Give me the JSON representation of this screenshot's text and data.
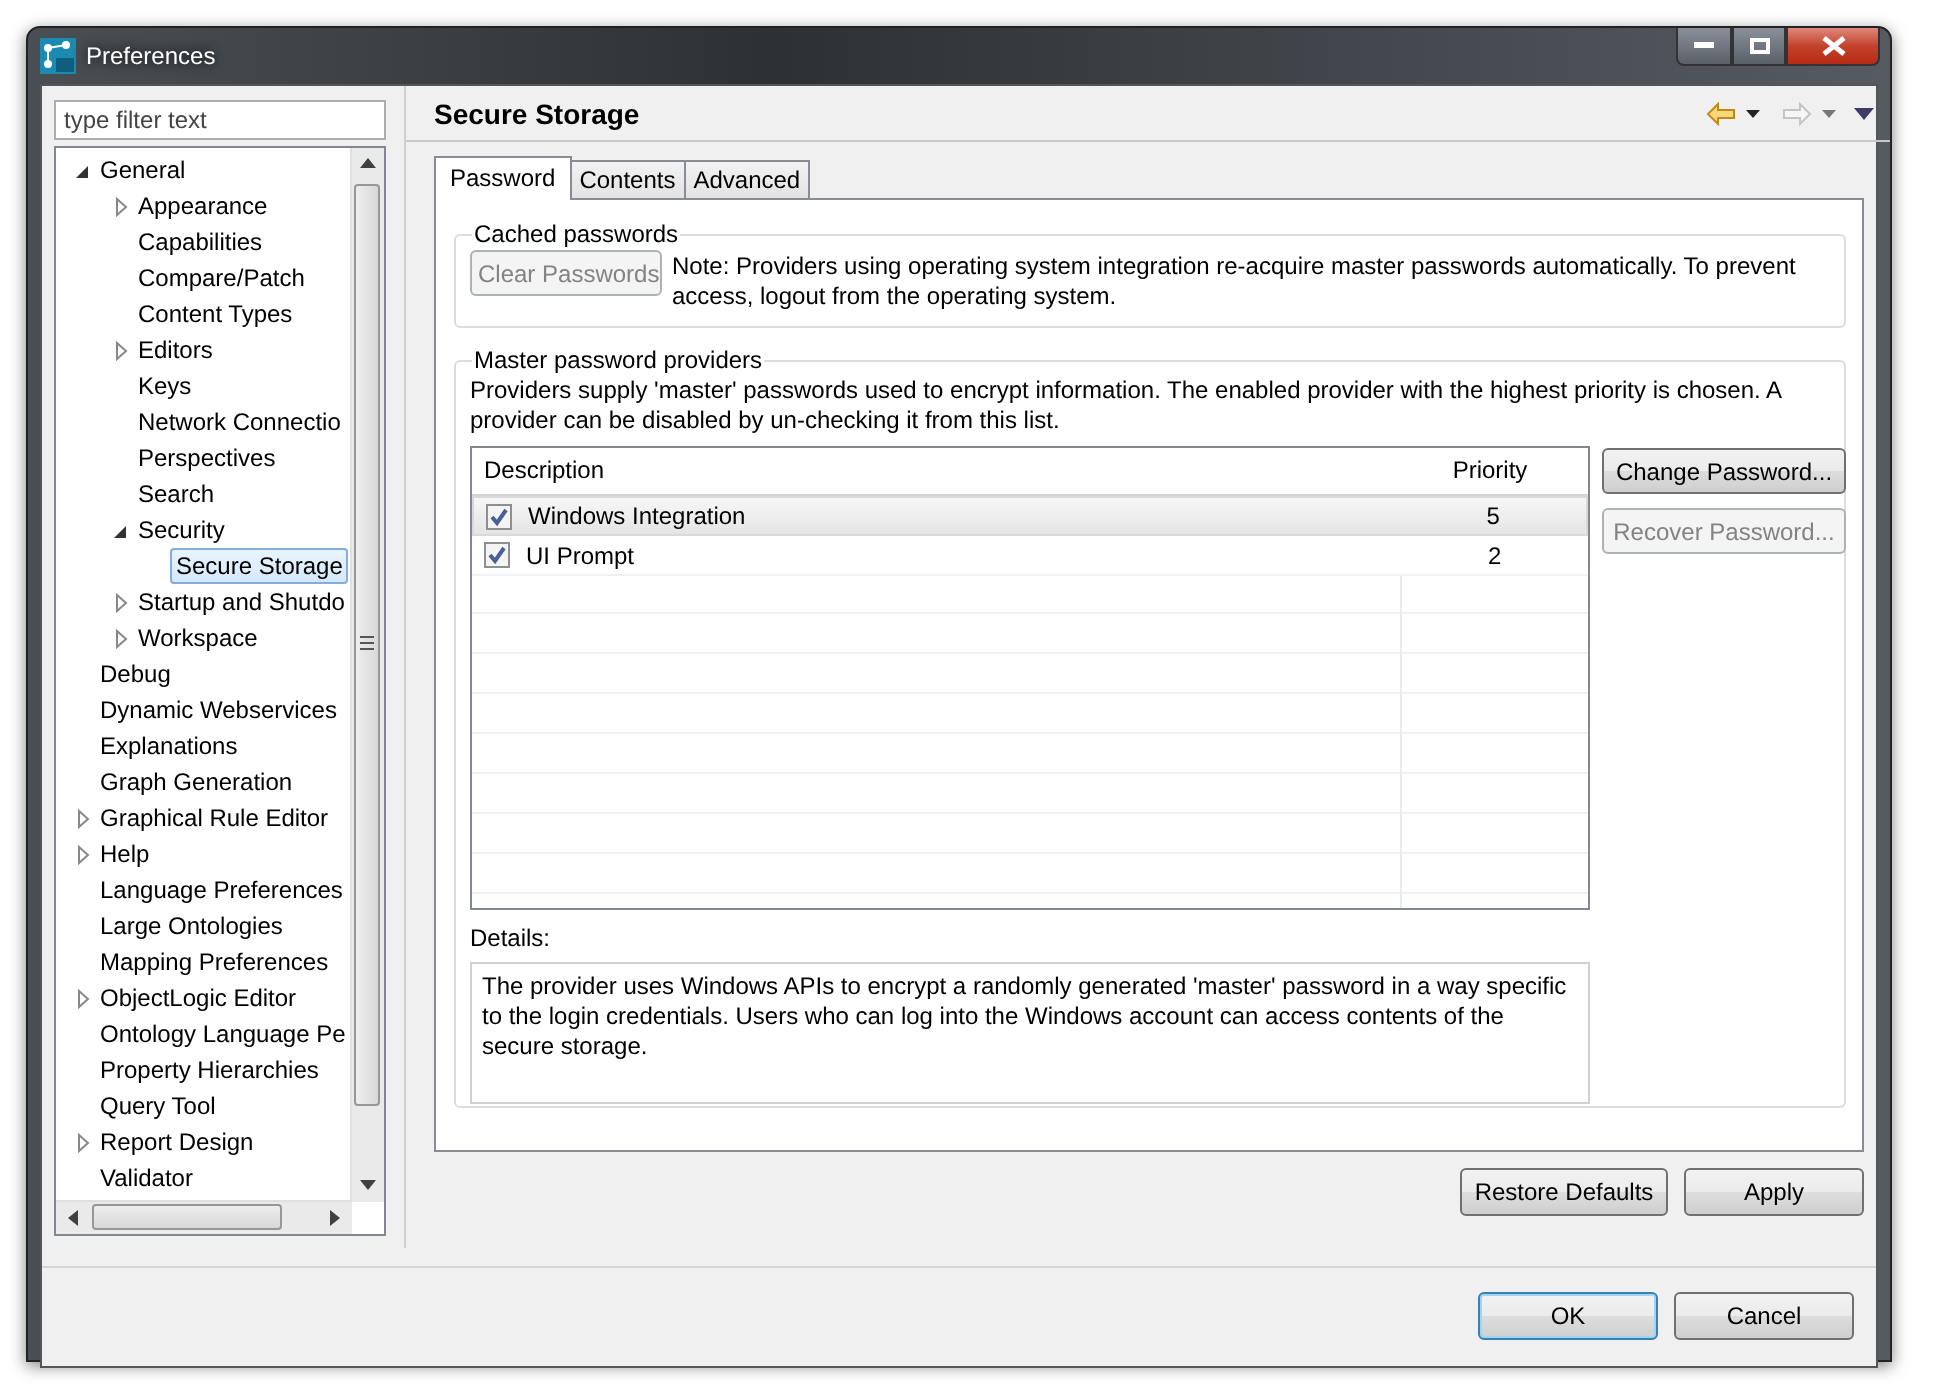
{
  "window": {
    "title": "Preferences"
  },
  "filter": {
    "placeholder": "type filter text"
  },
  "tree": [
    {
      "label": "General",
      "kind": "branch",
      "expanded": true,
      "selected": false,
      "children": [
        {
          "label": "Appearance",
          "kind": "branch",
          "expanded": false,
          "selected": false
        },
        {
          "label": "Capabilities",
          "kind": "leaf",
          "selected": false
        },
        {
          "label": "Compare/Patch",
          "kind": "leaf",
          "selected": false
        },
        {
          "label": "Content Types",
          "kind": "leaf",
          "selected": false
        },
        {
          "label": "Editors",
          "kind": "branch",
          "expanded": false,
          "selected": false
        },
        {
          "label": "Keys",
          "kind": "leaf",
          "selected": false
        },
        {
          "label": "Network Connectio",
          "kind": "leaf",
          "selected": false
        },
        {
          "label": "Perspectives",
          "kind": "leaf",
          "selected": false
        },
        {
          "label": "Search",
          "kind": "leaf",
          "selected": false
        },
        {
          "label": "Security",
          "kind": "branch",
          "expanded": true,
          "selected": false,
          "children": [
            {
              "label": "Secure Storage",
              "kind": "leaf",
              "selected": true
            }
          ]
        },
        {
          "label": "Startup and Shutdo",
          "kind": "branch",
          "expanded": false,
          "selected": false
        },
        {
          "label": "Workspace",
          "kind": "branch",
          "expanded": false,
          "selected": false
        }
      ]
    },
    {
      "label": "Debug",
      "kind": "leaf",
      "selected": false
    },
    {
      "label": "Dynamic Webservices",
      "kind": "leaf",
      "selected": false
    },
    {
      "label": "Explanations",
      "kind": "leaf",
      "selected": false
    },
    {
      "label": "Graph Generation",
      "kind": "leaf",
      "selected": false
    },
    {
      "label": "Graphical Rule Editor",
      "kind": "branch",
      "expanded": false,
      "selected": false
    },
    {
      "label": "Help",
      "kind": "branch",
      "expanded": false,
      "selected": false
    },
    {
      "label": "Language Preferences",
      "kind": "leaf",
      "selected": false
    },
    {
      "label": "Large Ontologies",
      "kind": "leaf",
      "selected": false
    },
    {
      "label": "Mapping Preferences",
      "kind": "leaf",
      "selected": false
    },
    {
      "label": "ObjectLogic Editor",
      "kind": "branch",
      "expanded": false,
      "selected": false
    },
    {
      "label": "Ontology Language Pe",
      "kind": "leaf",
      "selected": false
    },
    {
      "label": "Property Hierarchies",
      "kind": "leaf",
      "selected": false
    },
    {
      "label": "Query Tool",
      "kind": "leaf",
      "selected": false
    },
    {
      "label": "Report Design",
      "kind": "branch",
      "expanded": false,
      "selected": false
    },
    {
      "label": "Validator",
      "kind": "leaf",
      "selected": false
    }
  ],
  "page": {
    "title": "Secure Storage",
    "tabs": [
      {
        "label": "Password",
        "selected": true
      },
      {
        "label": "Contents",
        "selected": false
      },
      {
        "label": "Advanced",
        "selected": false
      }
    ],
    "cached": {
      "legend": "Cached passwords",
      "button": {
        "label": "Clear Passwords",
        "disabled": true
      },
      "note": "Note: Providers using operating system integration re-acquire master passwords automatically. To prevent access, logout from the operating system."
    },
    "providers": {
      "legend": "Master password providers",
      "intro": "Providers supply 'master' passwords used to encrypt information. The enabled provider with the highest priority is chosen. A provider can be disabled by un-checking it from this list.",
      "columns": [
        "Description",
        "Priority"
      ],
      "rows": [
        {
          "name": "Windows Integration",
          "priority": "5",
          "checked": true,
          "selected": true
        },
        {
          "name": "UI Prompt",
          "priority": "2",
          "checked": true,
          "selected": false
        }
      ],
      "buttons": [
        {
          "label": "Change Password...",
          "disabled": false
        },
        {
          "label": "Recover Password...",
          "disabled": true
        }
      ],
      "details_label": "Details:",
      "details": "The provider uses Windows APIs to encrypt a randomly generated 'master' password in a way specific to the login credentials. Users who can log into the Windows account can access contents of the secure storage."
    }
  },
  "page_buttons": [
    "Restore Defaults",
    "Apply"
  ],
  "dialog_buttons": [
    {
      "label": "OK",
      "default": true
    },
    {
      "label": "Cancel",
      "default": false
    }
  ]
}
